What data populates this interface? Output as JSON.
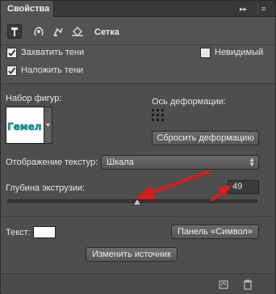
{
  "tab": {
    "title": "Свойства",
    "close_symbol": "×",
    "collapse_symbol": "▸▸",
    "menu_symbol": "≡"
  },
  "header": {
    "title": "Сетка",
    "icons": [
      "mesh-tool-icon",
      "deform-icon",
      "cap-icon",
      "coordinates-icon"
    ]
  },
  "options": {
    "cast_shadows": {
      "label": "Захватить тени",
      "checked": true
    },
    "catch_shadows": {
      "label": "Наложить тени",
      "checked": true
    },
    "invisible": {
      "label": "Невидимый",
      "checked": false
    }
  },
  "shape": {
    "label": "Набор фигур:",
    "preview_text": "Гемел"
  },
  "deformation": {
    "axis_label": "Ось деформации:",
    "reset_button": "Сбросить деформацию"
  },
  "texture": {
    "label": "Отображение текстур:",
    "value": "Шкала"
  },
  "extrusion": {
    "label": "Глубина экструзии:",
    "value": "49"
  },
  "text_section": {
    "label": "Текст:",
    "panel_button": "Панель «Символ»",
    "edit_source_button": "Изменить источник"
  },
  "colors": {
    "annotation_red": "#d21e1e",
    "panel_bg": "#535353",
    "shape_teal": "#1aa3a3"
  }
}
